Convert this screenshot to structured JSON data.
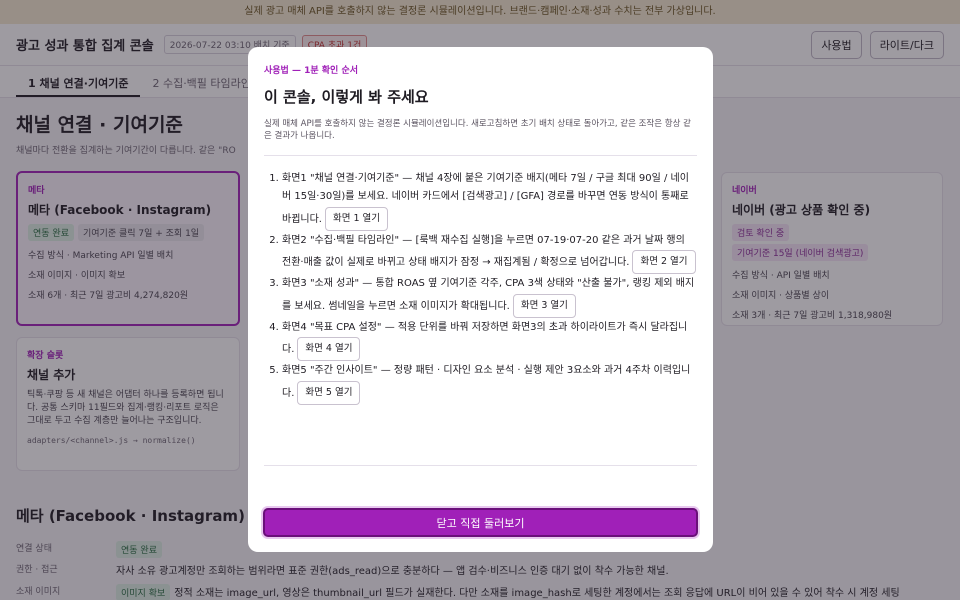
{
  "banner": "실제 광고 매체 API를 호출하지 않는 결정론 시뮬레이션입니다. 브랜드·캠페인·소재·성과 수치는 전부 가상입니다.",
  "header": {
    "title": "광고 성과 통합 집계 콘솔",
    "date_chip": "2026-07-22 03:10 배치 기준",
    "cpa_chip": "CPA 초과 1건",
    "help_button": "사용법",
    "theme_button": "라이트/다크"
  },
  "tabs": [
    "1 채널 연결·기여기준",
    "2 수집·백필 타임라인"
  ],
  "page": {
    "title": "채널 연결 · 기여기준",
    "subtitle": "채널마다 전환을 집계하는 기여기간이 다릅니다. 같은 \"RO"
  },
  "cards": {
    "meta": {
      "kicker": "메타",
      "name": "메타 (Facebook · Instagram)",
      "badge_status": "연동 완료",
      "badge_attr": "기여기준 클릭 7일 + 조회 1일",
      "line1": "수집 방식 · Marketing API 일별 배치",
      "line2": "소재 이미지 · 이미지 확보",
      "line3": "소재 6개 · 최근 7일 광고비 4,274,820원"
    },
    "naver": {
      "kicker": "네이버",
      "name": "네이버 (광고 상품 확인 중)",
      "badge_status": "검토 확인 중",
      "badge_attr": "기여기준 15일 (네이버 검색광고)",
      "line1": "수집 방식 · API 일별 배치",
      "line2": "소재 이미지 · 상품별 상이",
      "line3": "소재 3개 · 최근 7일 광고비 1,318,980원"
    },
    "extend": {
      "kicker": "확장 슬롯",
      "name": "채널 추가",
      "desc": "틱톡·쿠팡 등 새 채널은 어댑터 하나를 등록하면 됩니다. 공통 스키마 11필드와 집계·랭킹·리포트 로직은 그대로 두고 수집 계층만 늘어나는 구조입니다.",
      "code": "adapters/<channel>.js → normalize()"
    }
  },
  "detail": {
    "title": "메타 (Facebook · Instagram) 상세",
    "rows": [
      {
        "key": "연결 상태",
        "badge": "연동 완료",
        "value": ""
      },
      {
        "key": "권한 · 접근",
        "badge": "",
        "value": "자사 소유 광고계정만 조회하는 범위라면 표준 권한(ads_read)으로 충분하다 — 앱 검수·비즈니스 인증 대기 없이 착수 가능한 채널."
      },
      {
        "key": "소재 이미지",
        "badge": "이미지 확보",
        "value": "정적 소재는 image_url, 영상은 thumbnail_url 필드가 실재한다. 다만 소재를 image_hash로 세팅한 계정에서는 조회 응답에 URL이 비어 있을 수 있어 착수 시 계정 세팅"
      }
    ]
  },
  "modal": {
    "kicker": "사용법 — 1분 확인 순서",
    "title": "이 콘솔, 이렇게 봐 주세요",
    "intro": "실제 매체 API를 호출하지 않는 결정론 시뮬레이션입니다. 새로고침하면 초기 배치 상태로 돌아가고, 같은 조작은 항상 같은 결과가 나옵니다.",
    "steps": [
      {
        "text": "화면1 \"채널 연결·기여기준\" — 채널 4장에 붙은 기여기준 배지(메타 7일 / 구글 최대 90일 / 네이버 15일·30일)를 보세요. 네이버 카드에서 [검색광고] / [GFA] 경로를 바꾸면 연동 방식이 통째로 바뀝니다.",
        "button": "화면 1 열기"
      },
      {
        "text": "화면2 \"수집·백필 타임라인\" — [룩백 재수집 실행]을 누르면 07-19·07-20 같은 과거 날짜 행의 전환·매출 값이 실제로 바뀌고 상태 배지가 잠정 → 재집계됨 / 확정으로 넘어갑니다.",
        "button": "화면 2 열기"
      },
      {
        "text": "화면3 \"소재 성과\" — 통합 ROAS 옆 기여기준 각주, CPA 3색 상태와 \"산출 불가\", 랭킹 제외 배지를 보세요. 썸네일을 누르면 소재 이미지가 확대됩니다.",
        "button": "화면 3 열기"
      },
      {
        "text": "화면4 \"목표 CPA 설정\" — 적용 단위를 바꿔 저장하면 화면3의 초과 하이라이트가 즉시 달라집니다.",
        "button": "화면 4 열기"
      },
      {
        "text": "화면5 \"주간 인사이트\" — 정량 패턴 · 디자인 요소 분석 · 실행 제안 3요소와 과거 4주차 이력입니다.",
        "button": "화면 5 열기"
      }
    ],
    "close_button": "닫고 직접 둘러보기"
  }
}
